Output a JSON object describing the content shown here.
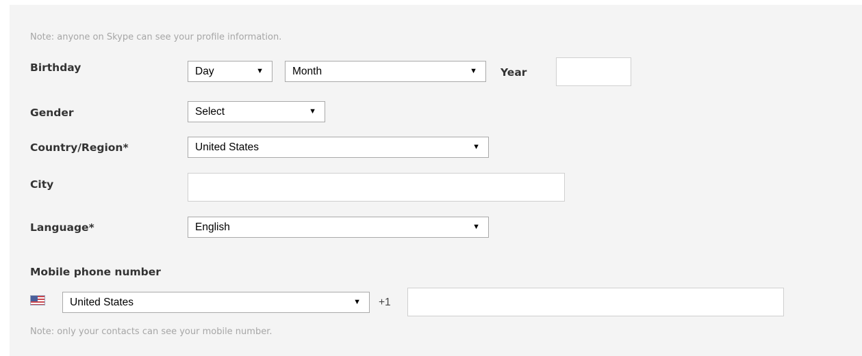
{
  "profile_note": "Note: anyone on Skype can see your profile information.",
  "birthday": {
    "label": "Birthday",
    "day_value": "Day",
    "month_value": "Month",
    "year_label": "Year",
    "year_value": ""
  },
  "gender": {
    "label": "Gender",
    "value": "Select"
  },
  "country": {
    "label": "Country/Region*",
    "value": "United States"
  },
  "city": {
    "label": "City",
    "value": ""
  },
  "language": {
    "label": "Language*",
    "value": "English"
  },
  "mobile": {
    "heading": "Mobile phone number",
    "flag_icon": "us-flag-icon",
    "country_value": "United States",
    "dial_code": "+1",
    "number_value": "",
    "note": "Note: only your contacts can see your mobile number."
  },
  "icons": {
    "dropdown": "chevron-down-icon",
    "arrow_glyph": "▼"
  }
}
